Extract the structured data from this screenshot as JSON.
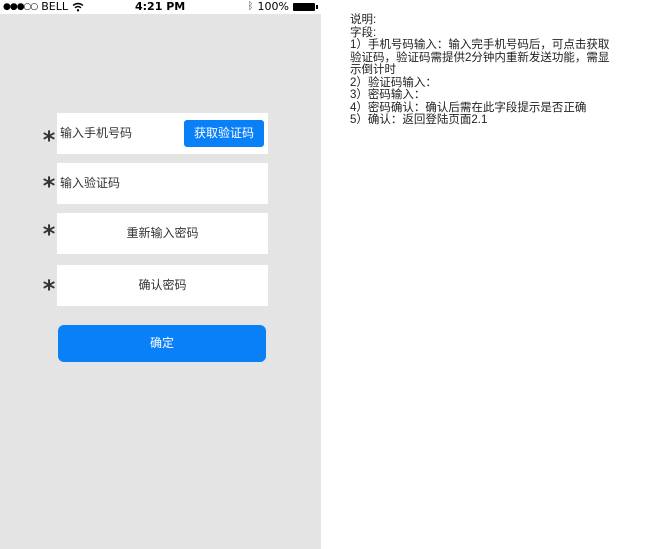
{
  "status_bar": {
    "carrier": "BELL",
    "time": "4:21 PM",
    "battery_percent": "100%"
  },
  "form": {
    "phone_field_placeholder": "输入手机号码",
    "get_code_button": "获取验证码",
    "code_field_placeholder": "输入验证码",
    "new_password_field": "重新输入密码",
    "confirm_password_field": "确认密码",
    "required_marker": "*",
    "confirm_button": "确定"
  },
  "notes": {
    "title": "说明:",
    "field_heading": "字段:",
    "lines": [
      "1）手机号码输入：输入完手机号码后，可点击获取",
      "验证码，验证码需提供2分钟内重新发送功能，需显",
      "示倒计时",
      "2）验证码输入：",
      "3）密码输入：",
      "4）密码确认：确认后需在此字段提示是否正确",
      "5）确认：返回登陆页面2.1"
    ]
  },
  "colors": {
    "phone_background": "#e4e4e4",
    "accent_blue": "#0a80f8",
    "field_background": "#ffffff"
  }
}
